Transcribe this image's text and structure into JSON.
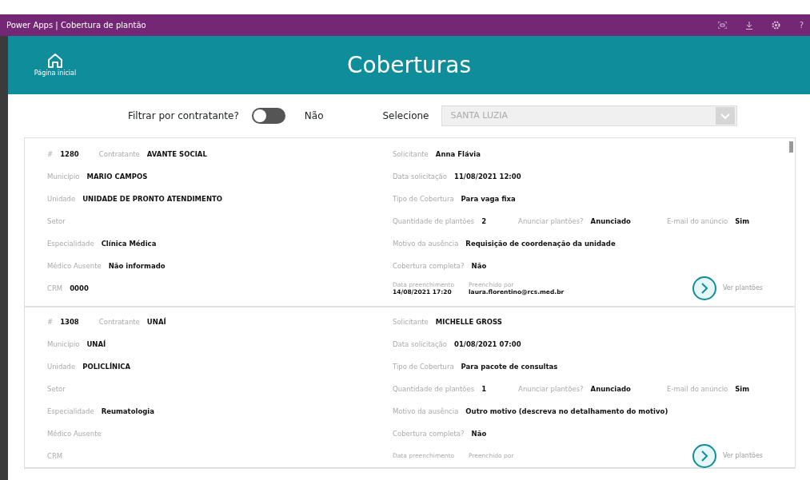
{
  "app_bar": {
    "title": "Power Apps | Cobertura de plantão",
    "help": "?"
  },
  "header": {
    "home_label": "Página inicial",
    "title": "Coberturas"
  },
  "filter": {
    "label": "Filtrar por contratante?",
    "toggle_on": false,
    "toggle_text": "Não",
    "select_label": "Selecione",
    "select_value": "SANTA LUZIA",
    "select_disabled": true
  },
  "records": [
    {
      "left_rows": [
        [
          {
            "label": "#",
            "value": "1280"
          },
          {
            "label": "Contratante",
            "value": "AVANTE SOCIAL"
          }
        ],
        [
          {
            "label": "Município",
            "value": "MARIO CAMPOS"
          }
        ],
        [
          {
            "label": "Unidade",
            "value": "UNIDADE DE PRONTO ATENDIMENTO"
          }
        ],
        [
          {
            "label": "Setor"
          }
        ],
        [
          {
            "label": "Especialidade",
            "value": "Clínica Médica"
          }
        ],
        [
          {
            "label": "Médico Ausente",
            "value": "Não informado"
          }
        ],
        [
          {
            "label": "CRM",
            "value": "0000"
          }
        ]
      ],
      "right_rows": [
        [
          {
            "label": "Solicitante",
            "value": "Anna Flávia"
          }
        ],
        [
          {
            "label": "Data solicitação",
            "value": "11/08/2021 12:00"
          }
        ],
        [
          {
            "label": "Tipo de Cobertura",
            "value": "Para vaga fixa"
          }
        ],
        [
          {
            "label": "Quantidade de plantões",
            "value": "2"
          },
          {
            "label": "Anunciar plantões?",
            "value": "Anunciado"
          },
          {
            "label": "E-mail do anúncio",
            "value": "Sim"
          }
        ],
        [
          {
            "label": "Motivo da ausência",
            "value": "Requisição de coordenação da unidade"
          }
        ],
        [
          {
            "label": "Cobertura completa?",
            "value": "Não"
          }
        ]
      ],
      "footer": [
        {
          "label": "Data preenchimento",
          "value": "14/08/2021 17:20"
        },
        {
          "label": "Preenchido por",
          "value": "laura.florentino@rcs.med.br"
        }
      ],
      "link": "Ver plantões"
    },
    {
      "left_rows": [
        [
          {
            "label": "#",
            "value": "1308"
          },
          {
            "label": "Contratante",
            "value": "UNAÍ"
          }
        ],
        [
          {
            "label": "Município",
            "value": "UNAÍ"
          }
        ],
        [
          {
            "label": "Unidade",
            "value": "POLICLÍNICA"
          }
        ],
        [
          {
            "label": "Setor"
          }
        ],
        [
          {
            "label": "Especialidade",
            "value": "Reumatologia"
          }
        ],
        [
          {
            "label": "Médico Ausente"
          }
        ],
        [
          {
            "label": "CRM"
          }
        ]
      ],
      "right_rows": [
        [
          {
            "label": "Solicitante",
            "value": "MICHELLE GROSS"
          }
        ],
        [
          {
            "label": "Data solicitação",
            "value": "01/08/2021 07:00"
          }
        ],
        [
          {
            "label": "Tipo de Cobertura",
            "value": "Para pacote de consultas"
          }
        ],
        [
          {
            "label": "Quantidade de plantões",
            "value": "1"
          },
          {
            "label": "Anunciar plantões?",
            "value": "Anunciado"
          },
          {
            "label": "E-mail do anúncio",
            "value": "Sim"
          }
        ],
        [
          {
            "label": "Motivo da ausência",
            "value": "Outro motivo (descreva no detalhamento do motivo)"
          }
        ],
        [
          {
            "label": "Cobertura completa?",
            "value": "Não"
          }
        ]
      ],
      "footer": [
        {
          "label": "Data preenchimento"
        },
        {
          "label": "Preenchido por"
        }
      ],
      "link": "Ver plantões"
    }
  ]
}
